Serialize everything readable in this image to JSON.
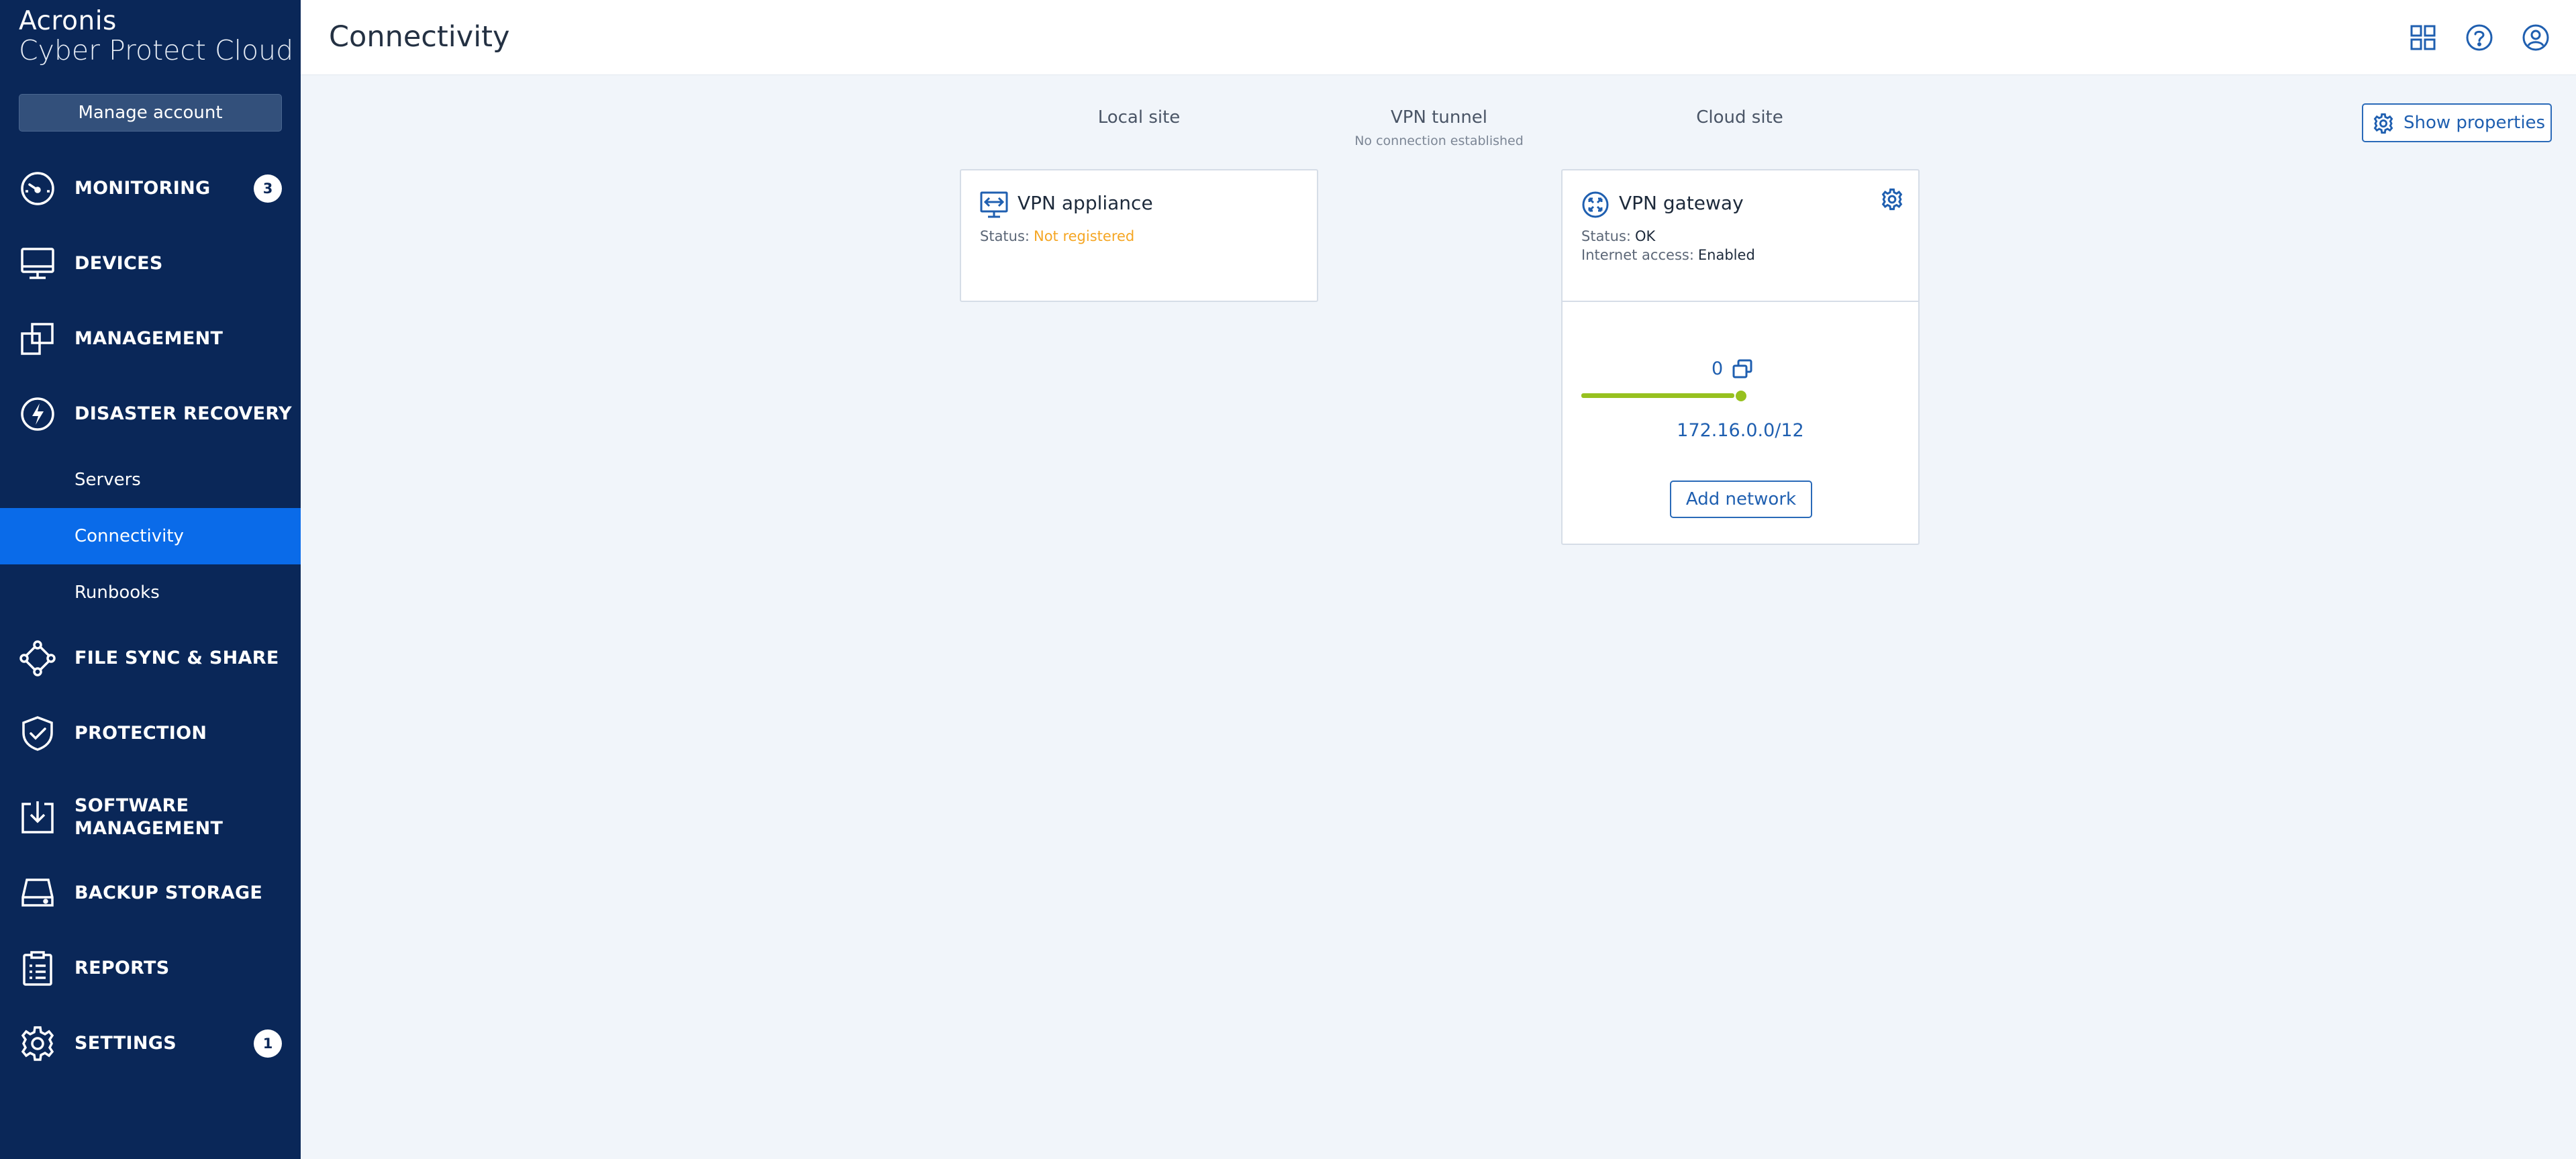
{
  "brand": {
    "line1": "Acronis",
    "line2": "Cyber Protect Cloud"
  },
  "sidebar": {
    "manage_account": "Manage account",
    "items": [
      {
        "label": "MONITORING",
        "icon": "gauge-icon",
        "badge": "3"
      },
      {
        "label": "DEVICES",
        "icon": "monitor-icon"
      },
      {
        "label": "MANAGEMENT",
        "icon": "stacked-squares-icon"
      },
      {
        "label": "DISASTER RECOVERY",
        "icon": "lightning-icon"
      },
      {
        "label": "FILE SYNC & SHARE",
        "icon": "share-nodes-icon"
      },
      {
        "label": "PROTECTION",
        "icon": "shield-icon"
      },
      {
        "label": "SOFTWARE",
        "label2": "MANAGEMENT",
        "icon": "download-box-icon"
      },
      {
        "label": "BACKUP STORAGE",
        "icon": "drive-icon"
      },
      {
        "label": "REPORTS",
        "icon": "clipboard-icon"
      },
      {
        "label": "SETTINGS",
        "icon": "gear-icon",
        "badge": "1"
      }
    ],
    "subitems": [
      {
        "label": "Servers"
      },
      {
        "label": "Connectivity",
        "active": true
      },
      {
        "label": "Runbooks"
      }
    ]
  },
  "header": {
    "title": "Connectivity",
    "icons": [
      "grid-icon",
      "help-icon",
      "user-icon"
    ]
  },
  "main": {
    "columns": {
      "local": "Local site",
      "tunnel": "VPN tunnel",
      "tunnel_status": "No connection established",
      "cloud": "Cloud site"
    },
    "show_properties": "Show properties",
    "appliance": {
      "title": "VPN appliance",
      "status_label": "Status:",
      "status_value": "Not registered"
    },
    "gateway": {
      "title": "VPN gateway",
      "status_label": "Status:",
      "status_value": "OK",
      "internet_label": "Internet access:",
      "internet_value": "Enabled",
      "network_count": "0",
      "network_ip": "172.16.0.0/12",
      "add_network": "Add network"
    }
  },
  "colors": {
    "sidebar": "#0a2758",
    "active": "#0a6be9",
    "accent": "#1f5fb0",
    "warning": "#f5a623",
    "network_line": "#97c11f"
  }
}
